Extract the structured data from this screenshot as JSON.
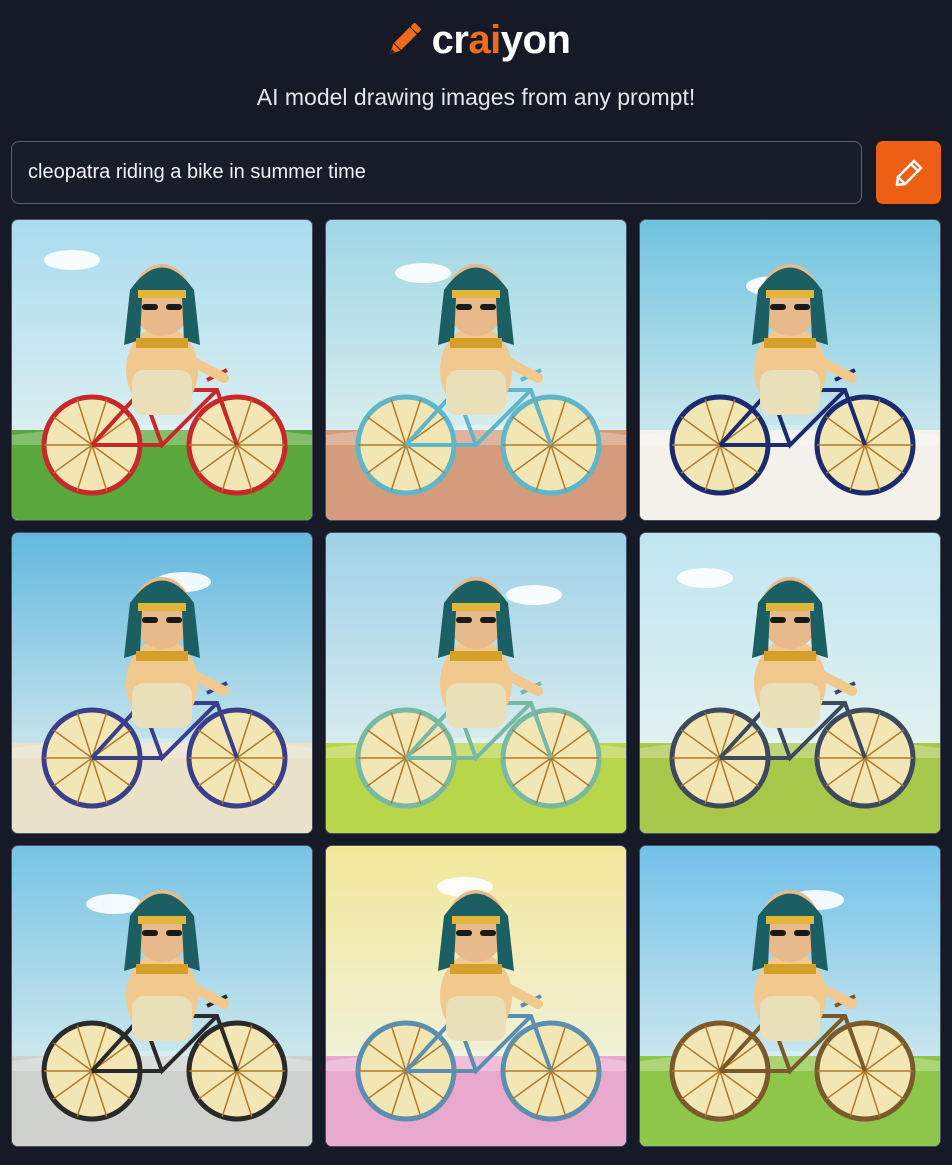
{
  "header": {
    "logo_prefix": "cr",
    "logo_ai": "ai",
    "logo_suffix": "yon",
    "tagline": "AI model drawing images from any prompt!"
  },
  "search": {
    "value": "cleopatra riding a bike in summer time"
  },
  "colors": {
    "background": "#151a26",
    "accent": "#ec5f15"
  },
  "icons": {
    "logo": "pencil-icon",
    "draw_button": "pencil-icon"
  },
  "results": {
    "count": 9,
    "tiles": [
      {
        "name": "result-image-1",
        "sky": "#a9dcef",
        "ground": "#5aa83b"
      },
      {
        "name": "result-image-2",
        "sky": "#9fd7e6",
        "ground": "#d59b7d"
      },
      {
        "name": "result-image-3",
        "sky": "#6fc3e0",
        "ground": "#f3f1ea"
      },
      {
        "name": "result-image-4",
        "sky": "#63b8df",
        "ground": "#e9e2c9"
      },
      {
        "name": "result-image-5",
        "sky": "#9fd1e8",
        "ground": "#b8d64a"
      },
      {
        "name": "result-image-6",
        "sky": "#bfe6f1",
        "ground": "#a8c84c"
      },
      {
        "name": "result-image-7",
        "sky": "#77c3e5",
        "ground": "#cfd2cc"
      },
      {
        "name": "result-image-8",
        "sky": "#f3e79a",
        "ground": "#e9a9cf"
      },
      {
        "name": "result-image-9",
        "sky": "#71c1e8",
        "ground": "#8ec64a"
      }
    ]
  }
}
